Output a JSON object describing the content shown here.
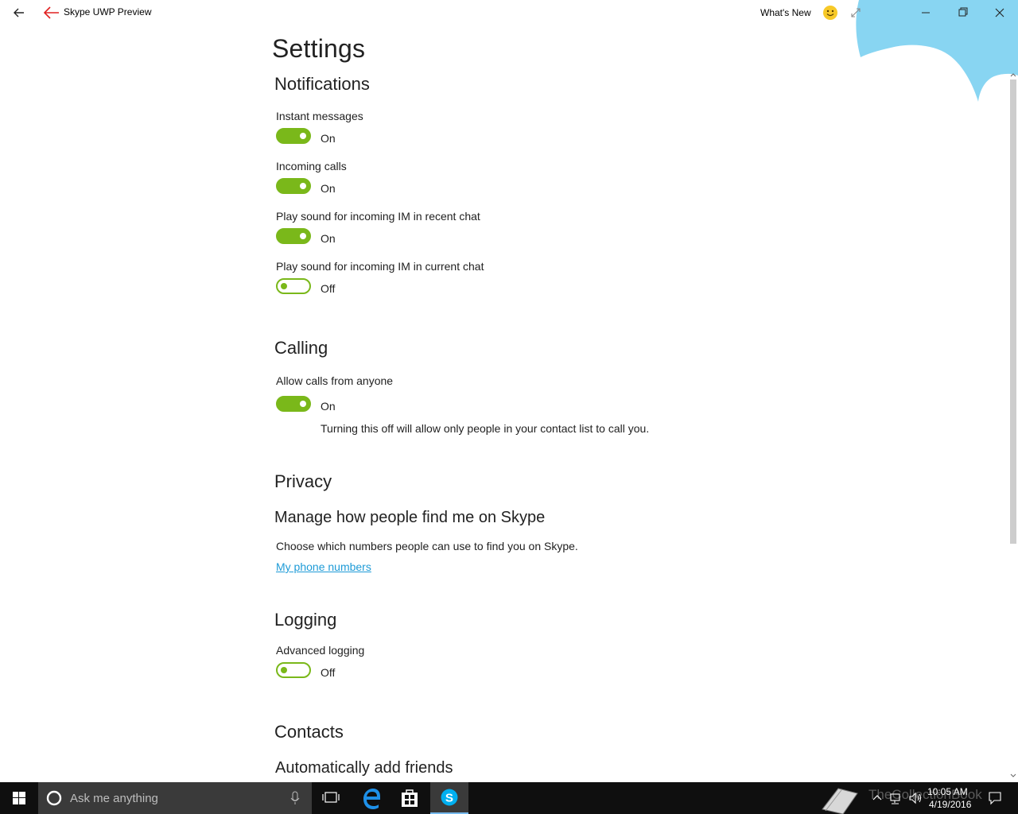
{
  "window": {
    "app_title": "Skype UWP Preview",
    "whats_new": "What's New",
    "icons": [
      "back-arrow-icon",
      "red-back-arrow-icon",
      "smiley-icon",
      "expand-icon",
      "minimize-icon",
      "maximize-icon",
      "close-icon"
    ]
  },
  "page": {
    "title": "Settings"
  },
  "notifications": {
    "heading": "Notifications",
    "items": [
      {
        "label": "Instant messages",
        "state": "On",
        "on": true
      },
      {
        "label": "Incoming calls",
        "state": "On",
        "on": true
      },
      {
        "label": "Play sound for incoming IM in recent chat",
        "state": "On",
        "on": true
      },
      {
        "label": "Play sound for incoming IM in current chat",
        "state": "Off",
        "on": false
      }
    ]
  },
  "calling": {
    "heading": "Calling",
    "allow_label": "Allow calls from anyone",
    "allow_state": "On",
    "allow_on": true,
    "note": "Turning this off will allow only people in your contact list to call you."
  },
  "privacy": {
    "heading": "Privacy",
    "subheading": "Manage how people find me on Skype",
    "description": "Choose which numbers people can use to find you on Skype.",
    "link": "My phone numbers"
  },
  "logging": {
    "heading": "Logging",
    "label": "Advanced logging",
    "state": "Off",
    "on": false
  },
  "contacts": {
    "heading": "Contacts",
    "subheading": "Automatically add friends"
  },
  "taskbar": {
    "search_placeholder": "Ask me anything",
    "watermark": "TheCollectionBook",
    "time": "10:05 AM",
    "date": "4/19/2016"
  },
  "colors": {
    "toggle_accent": "#7ab81a",
    "link": "#1e9bd7",
    "cloud": "#88d5f2",
    "taskbar": "#0f0f0f"
  }
}
